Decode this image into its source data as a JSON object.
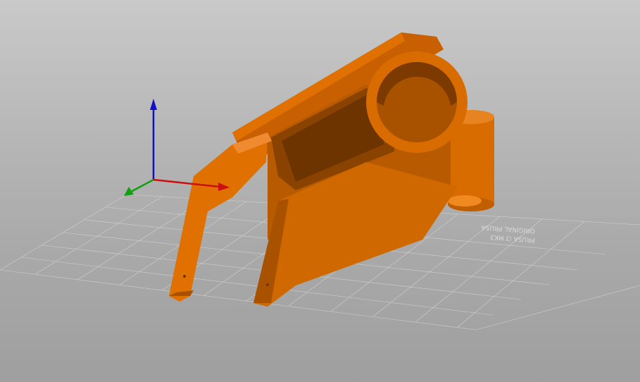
{
  "viewport": {
    "background_top": "#c9c9c9",
    "background_bottom": "#9f9f9f"
  },
  "bed": {
    "label_line_1": "PRUSA i3 MK3",
    "label_line_2": "ORIGINAL PRUSA"
  },
  "model": {
    "color": "#e07000",
    "shadow_color": "#a04c00"
  },
  "axes": {
    "x_color": "#cc0000",
    "y_color": "#00aa00",
    "z_color": "#0000cc"
  }
}
